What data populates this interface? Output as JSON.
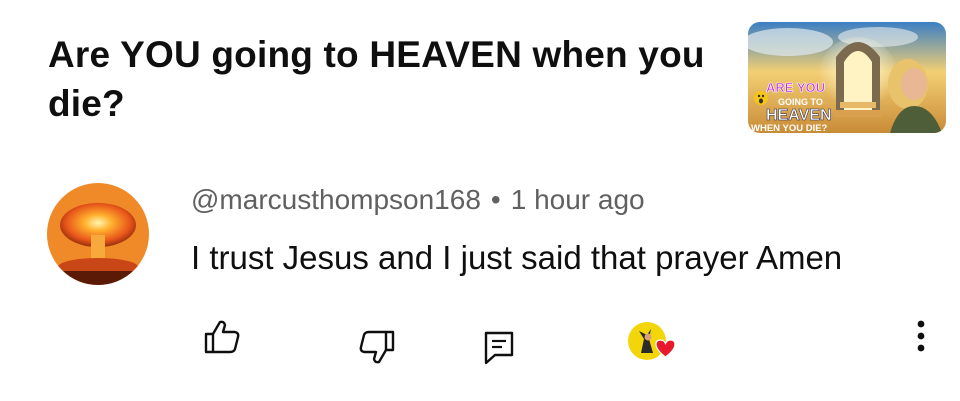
{
  "video": {
    "title": "Are YOU going to HEAVEN when you die?",
    "thumbnail": {
      "line1": "ARE YOU",
      "line2": "GOING TO",
      "line3": "HEAVEN",
      "line4": "WHEN YOU DIE?"
    }
  },
  "comment": {
    "author": "@marcusthompson168",
    "separator": "•",
    "time": "1 hour ago",
    "text": "I trust Jesus and I just said that prayer Amen"
  },
  "actions": {
    "like_icon": "thumbs-up-icon",
    "dislike_icon": "thumbs-down-icon",
    "reply_icon": "reply-icon",
    "creator_heart": "creator-heart-icon",
    "more_icon": "more-vertical-icon"
  },
  "colors": {
    "heart": "#e8192c",
    "avatar_ring": "#f2d60a"
  }
}
